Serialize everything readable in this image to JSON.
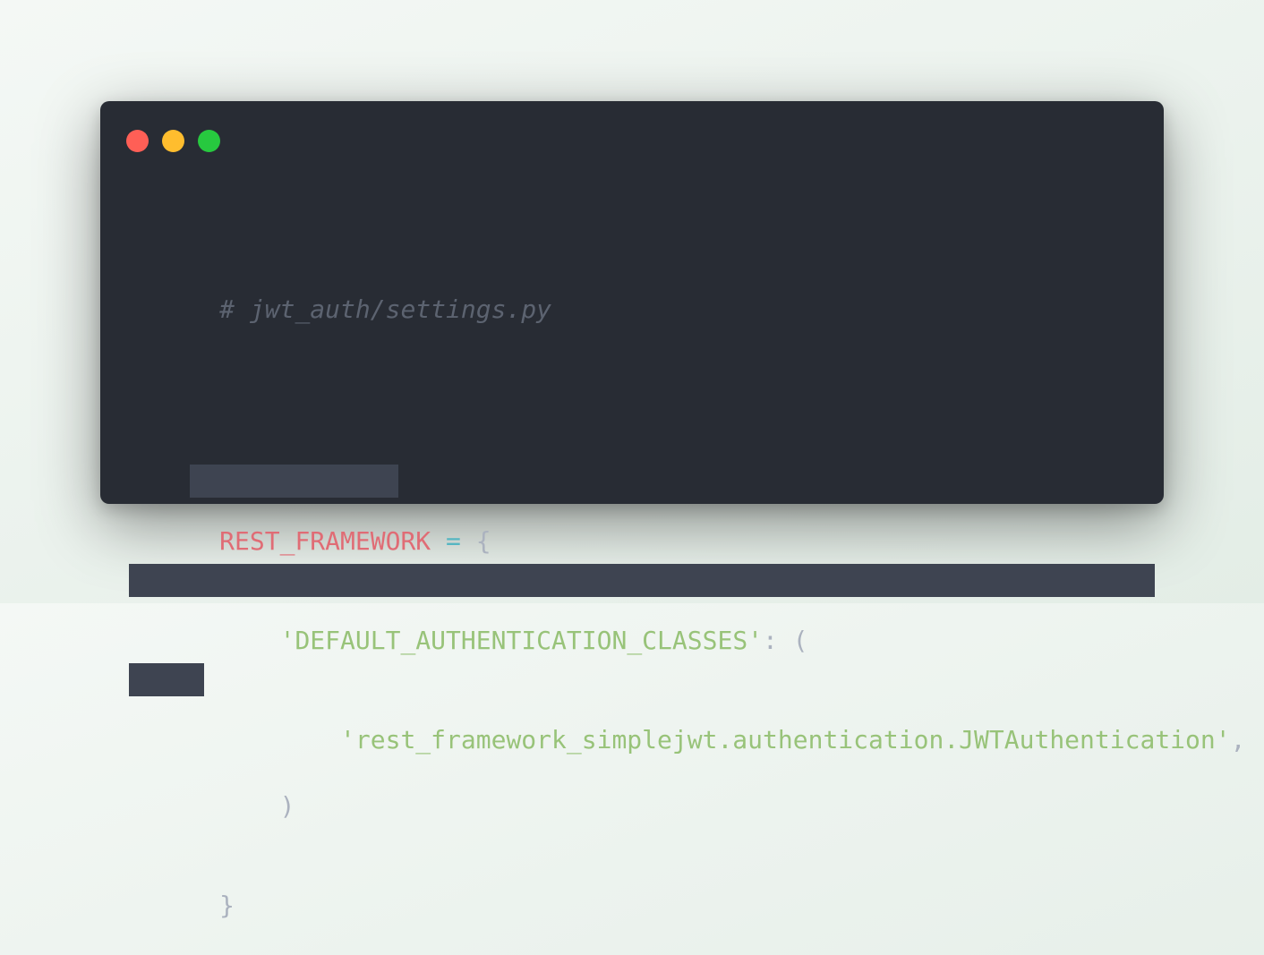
{
  "window_controls": {
    "close_color": "#ff5f56",
    "minimize_color": "#ffbd2e",
    "maximize_color": "#27c93f"
  },
  "code": {
    "language": "python",
    "theme_background": "#282c34",
    "selection_color": "#3e4451",
    "lines": [
      {
        "tokens": [
          {
            "type": "comment",
            "text": "# jwt_auth/settings.py"
          }
        ]
      },
      {
        "tokens": []
      },
      {
        "tokens": [
          {
            "type": "var",
            "text": "REST_FRAMEWORK"
          },
          {
            "type": "punct",
            "text": " "
          },
          {
            "type": "op",
            "text": "="
          },
          {
            "type": "punct",
            "text": " {"
          }
        ]
      },
      {
        "tokens": [
          {
            "type": "punct",
            "text": "    "
          },
          {
            "type": "str",
            "text": "'DEFAULT_AUTHENTICATION_CLASSES'"
          },
          {
            "type": "punct",
            "text": ": ("
          }
        ]
      },
      {
        "tokens": [
          {
            "type": "punct",
            "text": "        "
          },
          {
            "type": "str",
            "text": "'rest_framework_simplejwt.authentication.JWTAuthentication'"
          },
          {
            "type": "punct",
            "text": ","
          }
        ]
      },
      {
        "tokens": [
          {
            "type": "punct",
            "text": "    )"
          }
        ]
      },
      {
        "tokens": [
          {
            "type": "punct",
            "text": "}"
          }
        ]
      }
    ]
  }
}
